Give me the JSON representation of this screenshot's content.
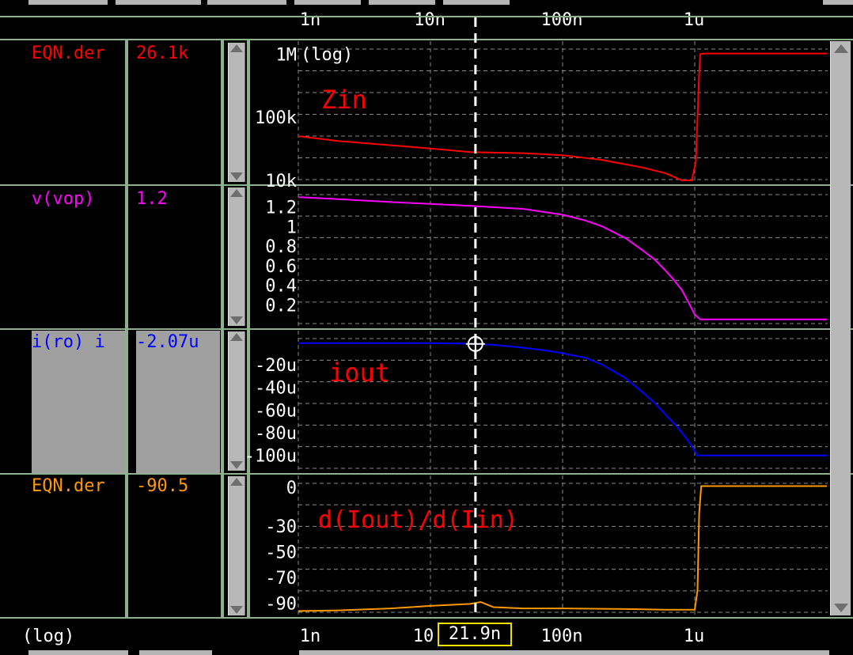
{
  "x_axis": {
    "ticks": [
      {
        "label": "1n",
        "value": 1e-09
      },
      {
        "label": "10n",
        "value": 1e-08
      },
      {
        "label": "100n",
        "value": 1e-07
      },
      {
        "label": "1u",
        "value": 1e-06
      }
    ],
    "bottom_labels": [
      "1n",
      "10",
      "100n",
      "1u"
    ],
    "scale_label": "(log)"
  },
  "cursor": {
    "x_label": "21.9n",
    "x_value": 2.19e-08
  },
  "signals": [
    {
      "name": "EQN.der",
      "value": "26.1k",
      "color": "#ff0000",
      "selected": false
    },
    {
      "name": "v(vop)",
      "value": "1.2",
      "color": "#ff00ff",
      "selected": false
    },
    {
      "name": "i(ro) i",
      "value": "-2.07u",
      "color": "#0000ff",
      "selected": true
    },
    {
      "name": "EQN.der",
      "value": "-90.5",
      "color": "#ff9900",
      "selected": false
    }
  ],
  "chart_data": [
    {
      "type": "line",
      "title": "",
      "annotation": "Zin",
      "yscale": "log",
      "yscale_label": "(log)",
      "ylim": [
        10000,
        1200000
      ],
      "yticks": [
        {
          "label": "1M",
          "value": 1000000
        },
        {
          "label": "100k",
          "value": 100000
        },
        {
          "label": "10k",
          "value": 10000
        }
      ],
      "series": [
        {
          "color": "#ff0000",
          "x": [
            1e-09,
            2e-09,
            5e-09,
            1e-08,
            2e-08,
            3e-08,
            5e-08,
            1e-07,
            2e-07,
            4e-07,
            6e-07,
            8e-07,
            9.5e-07,
            1.02e-06,
            1.05e-06,
            1.08e-06,
            1.1e-06,
            1.2e-06,
            2e-06,
            5e-06,
            1e-05
          ],
          "y": [
            50000,
            42000,
            36000,
            32000,
            28000,
            27500,
            27000,
            25000,
            21000,
            16000,
            13000,
            10000,
            10000,
            20000,
            100000,
            500000,
            1000000,
            1020000,
            1020000,
            1020000,
            1020000
          ]
        }
      ]
    },
    {
      "type": "line",
      "title": "",
      "ylim": [
        0,
        1.35
      ],
      "yticks": [
        {
          "label": "1.2",
          "value": 1.2
        },
        {
          "label": "1",
          "value": 1.0
        },
        {
          "label": "0.8",
          "value": 0.8
        },
        {
          "label": "0.6",
          "value": 0.6
        },
        {
          "label": "0.4",
          "value": 0.4
        },
        {
          "label": "0.2",
          "value": 0.2
        }
      ],
      "series": [
        {
          "color": "#ff00ff",
          "x": [
            1e-09,
            2e-09,
            5e-09,
            1e-08,
            2e-08,
            5e-08,
            1e-07,
            1.5e-07,
            2e-07,
            3e-07,
            4e-07,
            5e-07,
            6e-07,
            7e-07,
            8e-07,
            9e-07,
            1e-06,
            1.1e-06,
            2e-06,
            5e-06,
            1e-05
          ],
          "y": [
            1.3,
            1.28,
            1.25,
            1.23,
            1.21,
            1.18,
            1.12,
            1.06,
            1.0,
            0.88,
            0.76,
            0.66,
            0.55,
            0.45,
            0.35,
            0.22,
            0.1,
            0.05,
            0.05,
            0.05,
            0.05
          ]
        }
      ]
    },
    {
      "type": "line",
      "title": "",
      "annotation": "iout",
      "ylim": [
        -110,
        3
      ],
      "yticks": [
        {
          "label": "-20u",
          "value": -20
        },
        {
          "label": "-40u",
          "value": -40
        },
        {
          "label": "-60u",
          "value": -60
        },
        {
          "label": "-80u",
          "value": -80
        },
        {
          "label": "-100u",
          "value": -100
        }
      ],
      "series": [
        {
          "color": "#0000ff",
          "x": [
            1e-09,
            5e-09,
            1e-08,
            2e-08,
            3e-08,
            5e-08,
            8e-08,
            1e-07,
            1.5e-07,
            2e-07,
            3e-07,
            4e-07,
            5e-07,
            6e-07,
            7e-07,
            8e-07,
            9e-07,
            1.05e-06,
            1.2e-06,
            2e-06,
            1e-05
          ],
          "y": [
            -1,
            -1,
            -1,
            -1.5,
            -2.5,
            -5,
            -8,
            -10,
            -14,
            -20,
            -32,
            -44,
            -54,
            -64,
            -72,
            -80,
            -88,
            -100,
            -100,
            -100,
            -100
          ]
        }
      ]
    },
    {
      "type": "line",
      "title": "",
      "annotation": "d(Iout)/d(Iin)",
      "ylim": [
        -97,
        5
      ],
      "yticks": [
        {
          "label": "0",
          "value": 0
        },
        {
          "label": "-30",
          "value": -30
        },
        {
          "label": "-50",
          "value": -50
        },
        {
          "label": "-70",
          "value": -70
        },
        {
          "label": "-90",
          "value": -90
        }
      ],
      "series": [
        {
          "color": "#ff9900",
          "x": [
            1e-09,
            2e-09,
            5e-09,
            1e-08,
            2e-08,
            2.4e-08,
            3e-08,
            5e-08,
            1e-07,
            3e-07,
            6e-07,
            1e-06,
            1.05e-06,
            1.08e-06,
            1.12e-06,
            1.2e-06,
            2e-06,
            1e-05
          ],
          "y": [
            -96,
            -95.5,
            -94,
            -92,
            -90.5,
            -89,
            -93,
            -94,
            -94,
            -94.5,
            -95,
            -95,
            -80,
            -20,
            1,
            1,
            1,
            1
          ]
        }
      ]
    }
  ]
}
